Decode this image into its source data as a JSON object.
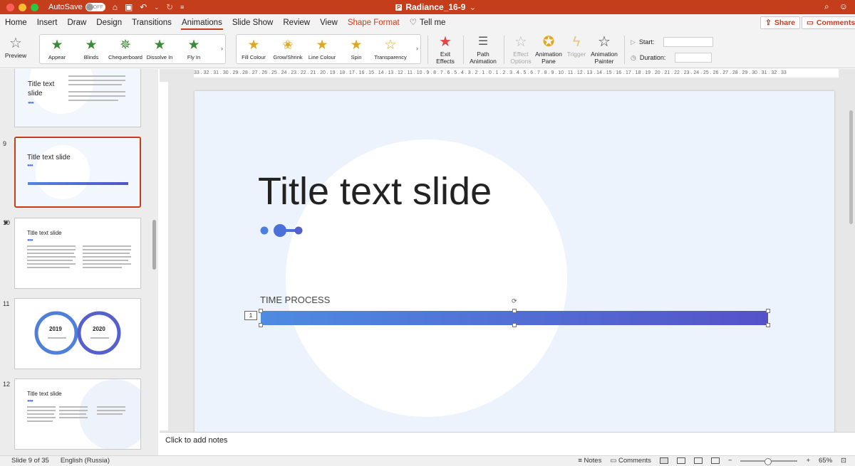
{
  "titlebar": {
    "autosave_label": "AutoSave",
    "autosave_state": "OFF",
    "doc_title": "Radiance_16-9",
    "doc_chevron": "⌄",
    "accent": "#c43e1c"
  },
  "tabs": [
    "Home",
    "Insert",
    "Draw",
    "Design",
    "Transitions",
    "Animations",
    "Slide Show",
    "Review",
    "View"
  ],
  "shape_format_tab": "Shape Format",
  "tellme_label": "Tell me",
  "share_label": "Share",
  "comments_label": "Comments",
  "ribbon": {
    "preview_label": "Preview",
    "entrance_effects": [
      "Appear",
      "Blinds",
      "Chequerboard",
      "Dissolve In",
      "Fly In"
    ],
    "emphasis_effects": [
      "Fill Colour",
      "Grow/Shrink",
      "Line Colour",
      "Spin",
      "Transparency"
    ],
    "exit_label_1": "Exit",
    "exit_label_2": "Effects",
    "path_label_1": "Path",
    "path_label_2": "Animation",
    "effect_options_1": "Effect",
    "effect_options_2": "Options",
    "anim_pane_1": "Animation",
    "anim_pane_2": "Pane",
    "trigger_label": "Trigger",
    "anim_painter_1": "Animation",
    "anim_painter_2": "Painter",
    "start_label": "Start:",
    "duration_label": "Duration:"
  },
  "thumbnails": [
    {
      "num": "",
      "title": "Title text\nslide"
    },
    {
      "num": "9",
      "title": "Title text slide",
      "subtitle": "TIME PROCESS"
    },
    {
      "num": "10",
      "title": "Title text slide"
    },
    {
      "num": "11",
      "year_left": "2019",
      "year_right": "2020"
    },
    {
      "num": "12",
      "title": "Title text slide"
    }
  ],
  "ruler_ticks": "33 . 32 . 31 . 30 . 29 . 28 . 27 . 26 . 25 . 24 . 23 . 22 . 21 . 20 . 19 . 18 . 17 . 16 . 15 . 14 . 13 . 12 . 11 . 10 . 9 . 8 . 7 . 6 . 5 . 4 . 3 . 2 . 1 . 0 . 1 . 2 . 3 . 4 . 5 . 6 . 7 . 8 . 9 . 10 . 11 . 12 . 13 . 14 . 15 . 16 . 17 . 18 . 19 . 20 . 21 . 22 . 23 . 24 . 25 . 26 . 27 . 28 . 29 . 30 . 31 . 32 . 33",
  "slide": {
    "title": "Title text slide",
    "label": "TIME PROCESS",
    "animation_order": "1"
  },
  "notes_placeholder": "Click to add notes",
  "status": {
    "slide_info": "Slide 9 of 35",
    "language": "English (Russia)",
    "notes_label": "Notes",
    "comments_label": "Comments",
    "zoom": "65%"
  }
}
